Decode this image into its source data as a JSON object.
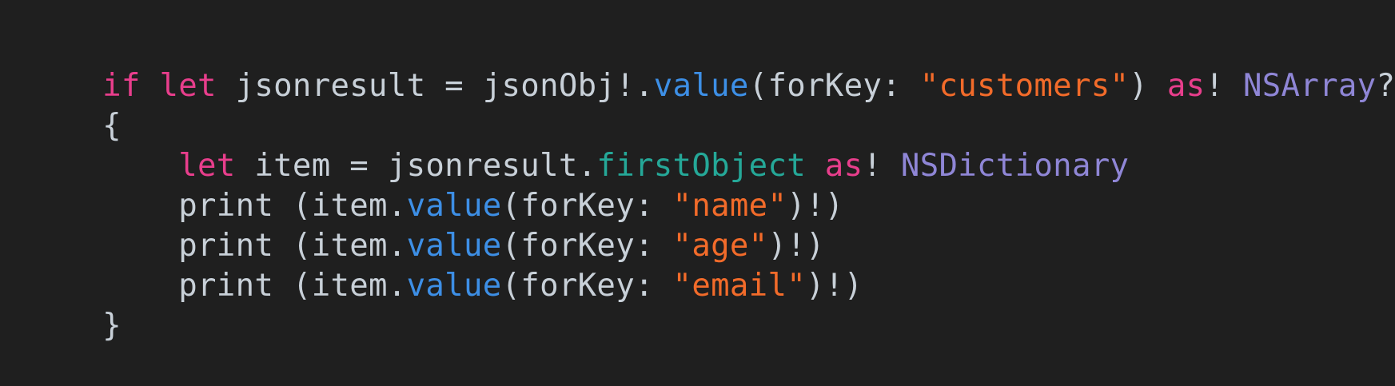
{
  "colors": {
    "background": "#1f1f1f",
    "plain": "#c8d0d8",
    "keyword": "#e83e8c",
    "function": "#3d8fe6",
    "string": "#f26b2a",
    "type": "#8f86d6",
    "property": "#25a898"
  },
  "code": {
    "lines": [
      {
        "tokens": [
          {
            "text": "if",
            "kind": "kw"
          },
          {
            "text": " ",
            "kind": "plain"
          },
          {
            "text": "let",
            "kind": "kw"
          },
          {
            "text": " jsonresult = jsonObj!.",
            "kind": "plain"
          },
          {
            "text": "value",
            "kind": "fn"
          },
          {
            "text": "(forKey: ",
            "kind": "plain"
          },
          {
            "text": "\"customers\"",
            "kind": "str"
          },
          {
            "text": ") ",
            "kind": "plain"
          },
          {
            "text": "as",
            "kind": "kw"
          },
          {
            "text": "! ",
            "kind": "plain"
          },
          {
            "text": "NSArray",
            "kind": "type"
          },
          {
            "text": "?",
            "kind": "plain"
          }
        ]
      },
      {
        "tokens": [
          {
            "text": "{",
            "kind": "plain"
          }
        ]
      },
      {
        "tokens": [
          {
            "text": "    ",
            "kind": "plain"
          },
          {
            "text": "let",
            "kind": "kw"
          },
          {
            "text": " item = jsonresult.",
            "kind": "plain"
          },
          {
            "text": "firstObject",
            "kind": "prop"
          },
          {
            "text": " ",
            "kind": "plain"
          },
          {
            "text": "as",
            "kind": "kw"
          },
          {
            "text": "! ",
            "kind": "plain"
          },
          {
            "text": "NSDictionary",
            "kind": "type"
          }
        ]
      },
      {
        "tokens": [
          {
            "text": "    print (item.",
            "kind": "plain"
          },
          {
            "text": "value",
            "kind": "fn"
          },
          {
            "text": "(forKey: ",
            "kind": "plain"
          },
          {
            "text": "\"name\"",
            "kind": "str"
          },
          {
            "text": ")!)",
            "kind": "plain"
          }
        ]
      },
      {
        "tokens": [
          {
            "text": "    print (item.",
            "kind": "plain"
          },
          {
            "text": "value",
            "kind": "fn"
          },
          {
            "text": "(forKey: ",
            "kind": "plain"
          },
          {
            "text": "\"age\"",
            "kind": "str"
          },
          {
            "text": ")!)",
            "kind": "plain"
          }
        ]
      },
      {
        "tokens": [
          {
            "text": "    print (item.",
            "kind": "plain"
          },
          {
            "text": "value",
            "kind": "fn"
          },
          {
            "text": "(forKey: ",
            "kind": "plain"
          },
          {
            "text": "\"email\"",
            "kind": "str"
          },
          {
            "text": ")!)",
            "kind": "plain"
          }
        ]
      },
      {
        "tokens": [
          {
            "text": "}",
            "kind": "plain"
          }
        ]
      }
    ]
  }
}
